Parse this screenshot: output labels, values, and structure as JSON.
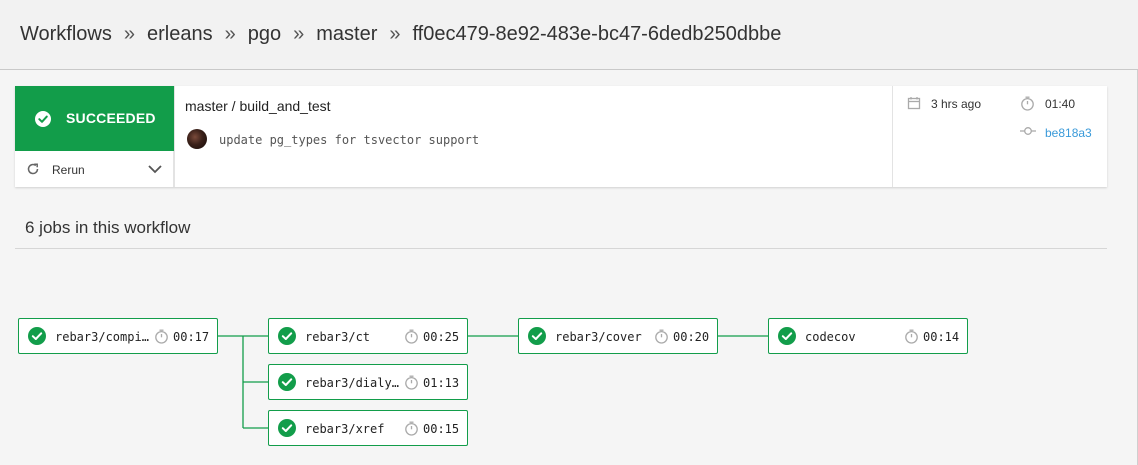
{
  "breadcrumb": {
    "items": [
      "Workflows",
      "erleans",
      "pgo",
      "master",
      "ff0ec479-8e92-483e-bc47-6dedb250dbbe"
    ],
    "separator": "»"
  },
  "workflow": {
    "status": "SUCCEEDED",
    "status_color": "#129d4a",
    "rerun_label": "Rerun",
    "title": "master / build_and_test",
    "commit_message": "update pg_types for tsvector support",
    "started": "3 hrs ago",
    "duration": "01:40",
    "commit_sha": "be818a3",
    "link_color": "#3a9ad9"
  },
  "jobs_section": {
    "heading": "6 jobs in this workflow",
    "jobs": [
      {
        "name": "rebar3/compile",
        "duration": "00:17",
        "status": "success"
      },
      {
        "name": "rebar3/ct",
        "duration": "00:25",
        "status": "success"
      },
      {
        "name": "rebar3/dialyz…",
        "duration": "01:13",
        "status": "success"
      },
      {
        "name": "rebar3/xref",
        "duration": "00:15",
        "status": "success"
      },
      {
        "name": "rebar3/cover",
        "duration": "00:20",
        "status": "success"
      },
      {
        "name": "codecov",
        "duration": "00:14",
        "status": "success"
      }
    ]
  }
}
